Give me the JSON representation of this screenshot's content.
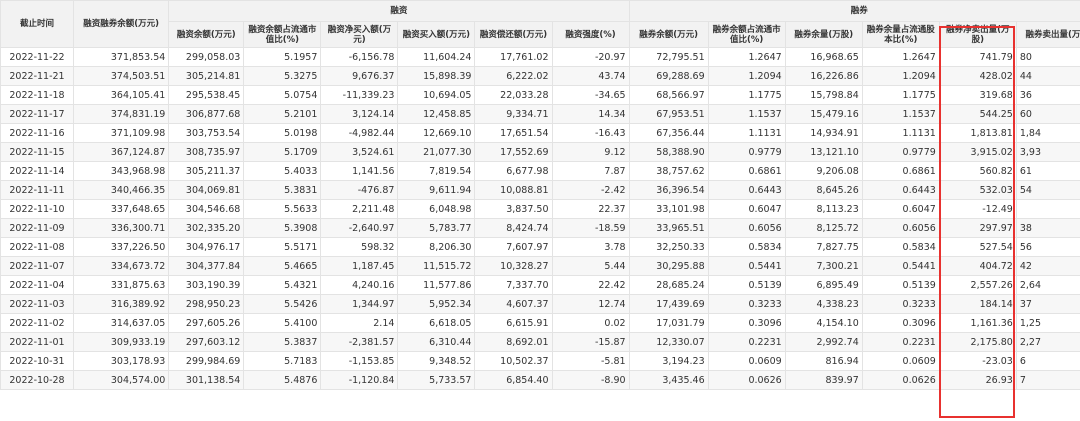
{
  "header": {
    "date": "截止时间",
    "total": "融资融券余额(万元)",
    "group_financing": "融资",
    "group_securities": "融券",
    "financing_cols": [
      "融资余额(万元)",
      "融资余额占流通市值比(%)",
      "融资净买入额(万元)",
      "融资买入额(万元)",
      "融资偿还额(万元)",
      "融资强度(%)"
    ],
    "securities_cols": [
      "融券余额(万元)",
      "融券余额占流通市值比(%)",
      "融券余量(万股)",
      "融券余量占流通股本比(%)",
      "融券净卖出量(万股)",
      "融券卖出量(万"
    ]
  },
  "accent": {
    "highlight_color": "#e8312f"
  },
  "rows": [
    {
      "date": "2022-11-22",
      "total": "371,853.54",
      "fin_bal": "299,058.03",
      "fin_ratio": "5.1957",
      "fin_net": "-6,156.78",
      "fin_buy": "11,604.24",
      "fin_repay": "17,761.02",
      "fin_strength": "-20.97",
      "sec_bal": "72,795.51",
      "sec_ratio": "1.2647",
      "sec_qty": "16,968.65",
      "sec_qty_ratio": "1.2647",
      "sec_net_sell": "741.79",
      "sec_sell": "80"
    },
    {
      "date": "2022-11-21",
      "total": "374,503.51",
      "fin_bal": "305,214.81",
      "fin_ratio": "5.3275",
      "fin_net": "9,676.37",
      "fin_buy": "15,898.39",
      "fin_repay": "6,222.02",
      "fin_strength": "43.74",
      "sec_bal": "69,288.69",
      "sec_ratio": "1.2094",
      "sec_qty": "16,226.86",
      "sec_qty_ratio": "1.2094",
      "sec_net_sell": "428.02",
      "sec_sell": "44"
    },
    {
      "date": "2022-11-18",
      "total": "364,105.41",
      "fin_bal": "295,538.45",
      "fin_ratio": "5.0754",
      "fin_net": "-11,339.23",
      "fin_buy": "10,694.05",
      "fin_repay": "22,033.28",
      "fin_strength": "-34.65",
      "sec_bal": "68,566.97",
      "sec_ratio": "1.1775",
      "sec_qty": "15,798.84",
      "sec_qty_ratio": "1.1775",
      "sec_net_sell": "319.68",
      "sec_sell": "36"
    },
    {
      "date": "2022-11-17",
      "total": "374,831.19",
      "fin_bal": "306,877.68",
      "fin_ratio": "5.2101",
      "fin_net": "3,124.14",
      "fin_buy": "12,458.85",
      "fin_repay": "9,334.71",
      "fin_strength": "14.34",
      "sec_bal": "67,953.51",
      "sec_ratio": "1.1537",
      "sec_qty": "15,479.16",
      "sec_qty_ratio": "1.1537",
      "sec_net_sell": "544.25",
      "sec_sell": "60"
    },
    {
      "date": "2022-11-16",
      "total": "371,109.98",
      "fin_bal": "303,753.54",
      "fin_ratio": "5.0198",
      "fin_net": "-4,982.44",
      "fin_buy": "12,669.10",
      "fin_repay": "17,651.54",
      "fin_strength": "-16.43",
      "sec_bal": "67,356.44",
      "sec_ratio": "1.1131",
      "sec_qty": "14,934.91",
      "sec_qty_ratio": "1.1131",
      "sec_net_sell": "1,813.81",
      "sec_sell": "1,84"
    },
    {
      "date": "2022-11-15",
      "total": "367,124.87",
      "fin_bal": "308,735.97",
      "fin_ratio": "5.1709",
      "fin_net": "3,524.61",
      "fin_buy": "21,077.30",
      "fin_repay": "17,552.69",
      "fin_strength": "9.12",
      "sec_bal": "58,388.90",
      "sec_ratio": "0.9779",
      "sec_qty": "13,121.10",
      "sec_qty_ratio": "0.9779",
      "sec_net_sell": "3,915.02",
      "sec_sell": "3,93"
    },
    {
      "date": "2022-11-14",
      "total": "343,968.98",
      "fin_bal": "305,211.37",
      "fin_ratio": "5.4033",
      "fin_net": "1,141.56",
      "fin_buy": "7,819.54",
      "fin_repay": "6,677.98",
      "fin_strength": "7.87",
      "sec_bal": "38,757.62",
      "sec_ratio": "0.6861",
      "sec_qty": "9,206.08",
      "sec_qty_ratio": "0.6861",
      "sec_net_sell": "560.82",
      "sec_sell": "61"
    },
    {
      "date": "2022-11-11",
      "total": "340,466.35",
      "fin_bal": "304,069.81",
      "fin_ratio": "5.3831",
      "fin_net": "-476.87",
      "fin_buy": "9,611.94",
      "fin_repay": "10,088.81",
      "fin_strength": "-2.42",
      "sec_bal": "36,396.54",
      "sec_ratio": "0.6443",
      "sec_qty": "8,645.26",
      "sec_qty_ratio": "0.6443",
      "sec_net_sell": "532.03",
      "sec_sell": "54"
    },
    {
      "date": "2022-11-10",
      "total": "337,648.65",
      "fin_bal": "304,546.68",
      "fin_ratio": "5.5633",
      "fin_net": "2,211.48",
      "fin_buy": "6,048.98",
      "fin_repay": "3,837.50",
      "fin_strength": "22.37",
      "sec_bal": "33,101.98",
      "sec_ratio": "0.6047",
      "sec_qty": "8,113.23",
      "sec_qty_ratio": "0.6047",
      "sec_net_sell": "-12.49",
      "sec_sell": ""
    },
    {
      "date": "2022-11-09",
      "total": "336,300.71",
      "fin_bal": "302,335.20",
      "fin_ratio": "5.3908",
      "fin_net": "-2,640.97",
      "fin_buy": "5,783.77",
      "fin_repay": "8,424.74",
      "fin_strength": "-18.59",
      "sec_bal": "33,965.51",
      "sec_ratio": "0.6056",
      "sec_qty": "8,125.72",
      "sec_qty_ratio": "0.6056",
      "sec_net_sell": "297.97",
      "sec_sell": "38"
    },
    {
      "date": "2022-11-08",
      "total": "337,226.50",
      "fin_bal": "304,976.17",
      "fin_ratio": "5.5171",
      "fin_net": "598.32",
      "fin_buy": "8,206.30",
      "fin_repay": "7,607.97",
      "fin_strength": "3.78",
      "sec_bal": "32,250.33",
      "sec_ratio": "0.5834",
      "sec_qty": "7,827.75",
      "sec_qty_ratio": "0.5834",
      "sec_net_sell": "527.54",
      "sec_sell": "56"
    },
    {
      "date": "2022-11-07",
      "total": "334,673.72",
      "fin_bal": "304,377.84",
      "fin_ratio": "5.4665",
      "fin_net": "1,187.45",
      "fin_buy": "11,515.72",
      "fin_repay": "10,328.27",
      "fin_strength": "5.44",
      "sec_bal": "30,295.88",
      "sec_ratio": "0.5441",
      "sec_qty": "7,300.21",
      "sec_qty_ratio": "0.5441",
      "sec_net_sell": "404.72",
      "sec_sell": "42"
    },
    {
      "date": "2022-11-04",
      "total": "331,875.63",
      "fin_bal": "303,190.39",
      "fin_ratio": "5.4321",
      "fin_net": "4,240.16",
      "fin_buy": "11,577.86",
      "fin_repay": "7,337.70",
      "fin_strength": "22.42",
      "sec_bal": "28,685.24",
      "sec_ratio": "0.5139",
      "sec_qty": "6,895.49",
      "sec_qty_ratio": "0.5139",
      "sec_net_sell": "2,557.26",
      "sec_sell": "2,64"
    },
    {
      "date": "2022-11-03",
      "total": "316,389.92",
      "fin_bal": "298,950.23",
      "fin_ratio": "5.5426",
      "fin_net": "1,344.97",
      "fin_buy": "5,952.34",
      "fin_repay": "4,607.37",
      "fin_strength": "12.74",
      "sec_bal": "17,439.69",
      "sec_ratio": "0.3233",
      "sec_qty": "4,338.23",
      "sec_qty_ratio": "0.3233",
      "sec_net_sell": "184.14",
      "sec_sell": "37"
    },
    {
      "date": "2022-11-02",
      "total": "314,637.05",
      "fin_bal": "297,605.26",
      "fin_ratio": "5.4100",
      "fin_net": "2.14",
      "fin_buy": "6,618.05",
      "fin_repay": "6,615.91",
      "fin_strength": "0.02",
      "sec_bal": "17,031.79",
      "sec_ratio": "0.3096",
      "sec_qty": "4,154.10",
      "sec_qty_ratio": "0.3096",
      "sec_net_sell": "1,161.36",
      "sec_sell": "1,25"
    },
    {
      "date": "2022-11-01",
      "total": "309,933.19",
      "fin_bal": "297,603.12",
      "fin_ratio": "5.3837",
      "fin_net": "-2,381.57",
      "fin_buy": "6,310.44",
      "fin_repay": "8,692.01",
      "fin_strength": "-15.87",
      "sec_bal": "12,330.07",
      "sec_ratio": "0.2231",
      "sec_qty": "2,992.74",
      "sec_qty_ratio": "0.2231",
      "sec_net_sell": "2,175.80",
      "sec_sell": "2,27"
    },
    {
      "date": "2022-10-31",
      "total": "303,178.93",
      "fin_bal": "299,984.69",
      "fin_ratio": "5.7183",
      "fin_net": "-1,153.85",
      "fin_buy": "9,348.52",
      "fin_repay": "10,502.37",
      "fin_strength": "-5.81",
      "sec_bal": "3,194.23",
      "sec_ratio": "0.0609",
      "sec_qty": "816.94",
      "sec_qty_ratio": "0.0609",
      "sec_net_sell": "-23.03",
      "sec_sell": "6"
    },
    {
      "date": "2022-10-28",
      "total": "304,574.00",
      "fin_bal": "301,138.54",
      "fin_ratio": "5.4876",
      "fin_net": "-1,120.84",
      "fin_buy": "5,733.57",
      "fin_repay": "6,854.40",
      "fin_strength": "-8.90",
      "sec_bal": "3,435.46",
      "sec_ratio": "0.0626",
      "sec_qty": "839.97",
      "sec_qty_ratio": "0.0626",
      "sec_net_sell": "26.93",
      "sec_sell": "7"
    }
  ]
}
